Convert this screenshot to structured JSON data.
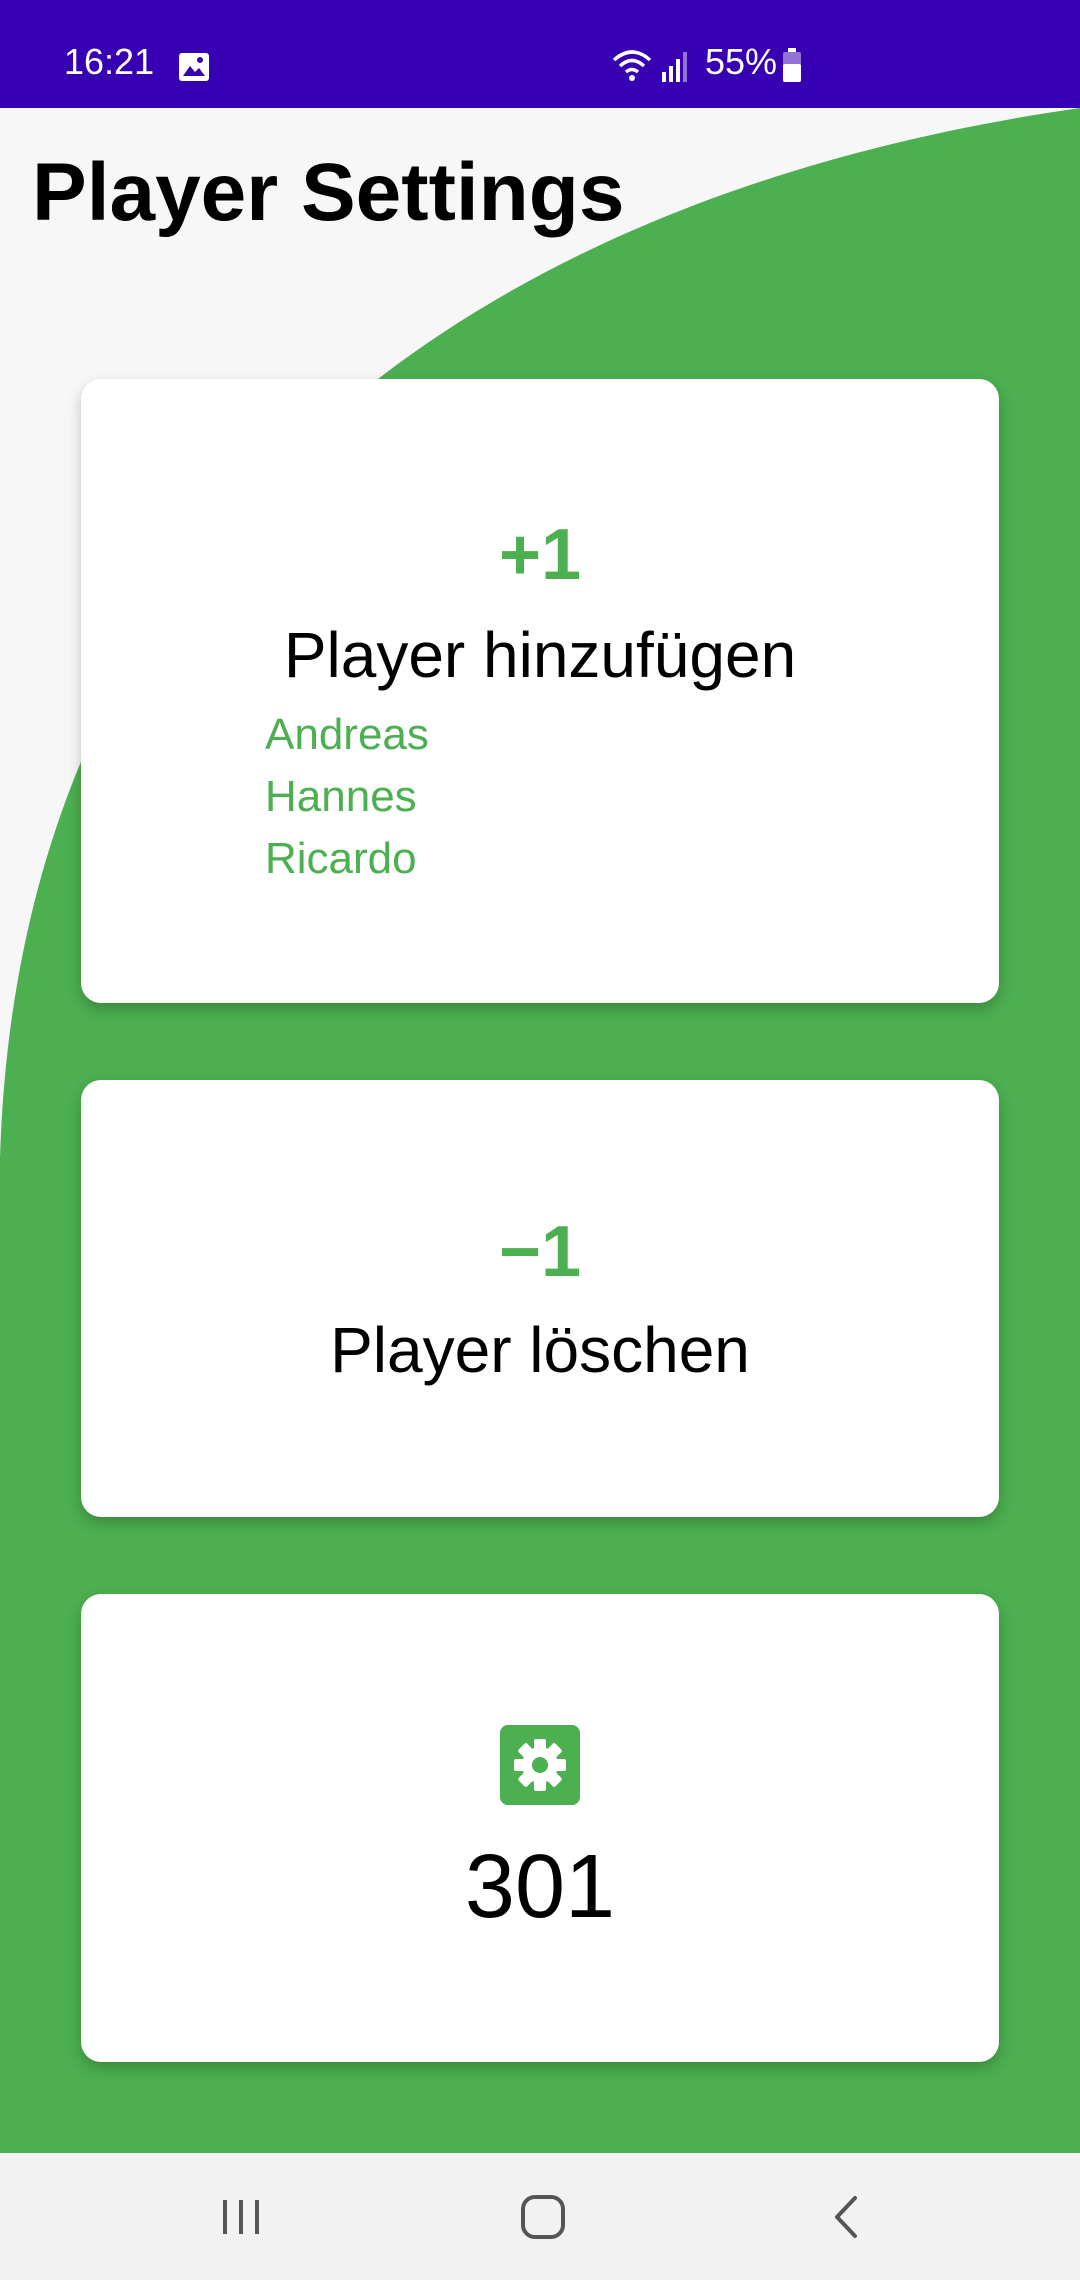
{
  "status_bar": {
    "time": "16:21",
    "battery": "55%",
    "icons": [
      "gallery-icon",
      "wifi-icon",
      "signal-icon",
      "battery-icon"
    ],
    "background_color": "#3700b3"
  },
  "header": {
    "title": "Player Settings"
  },
  "cards": {
    "add_player": {
      "symbol": "+1",
      "label": "Player hinzufügen",
      "players": [
        "Andreas",
        "Hannes",
        "Ricardo"
      ]
    },
    "delete_player": {
      "symbol": "−1",
      "label": "Player löschen"
    },
    "game_mode": {
      "icon": "settings-gear-icon",
      "value": "301"
    }
  },
  "nav_bar": {
    "buttons": [
      "recents-icon",
      "home-icon",
      "back-icon"
    ]
  },
  "colors": {
    "accent": "#4caf50",
    "status_bar": "#3700b3",
    "background": "#f7f7f7",
    "card": "#ffffff"
  }
}
